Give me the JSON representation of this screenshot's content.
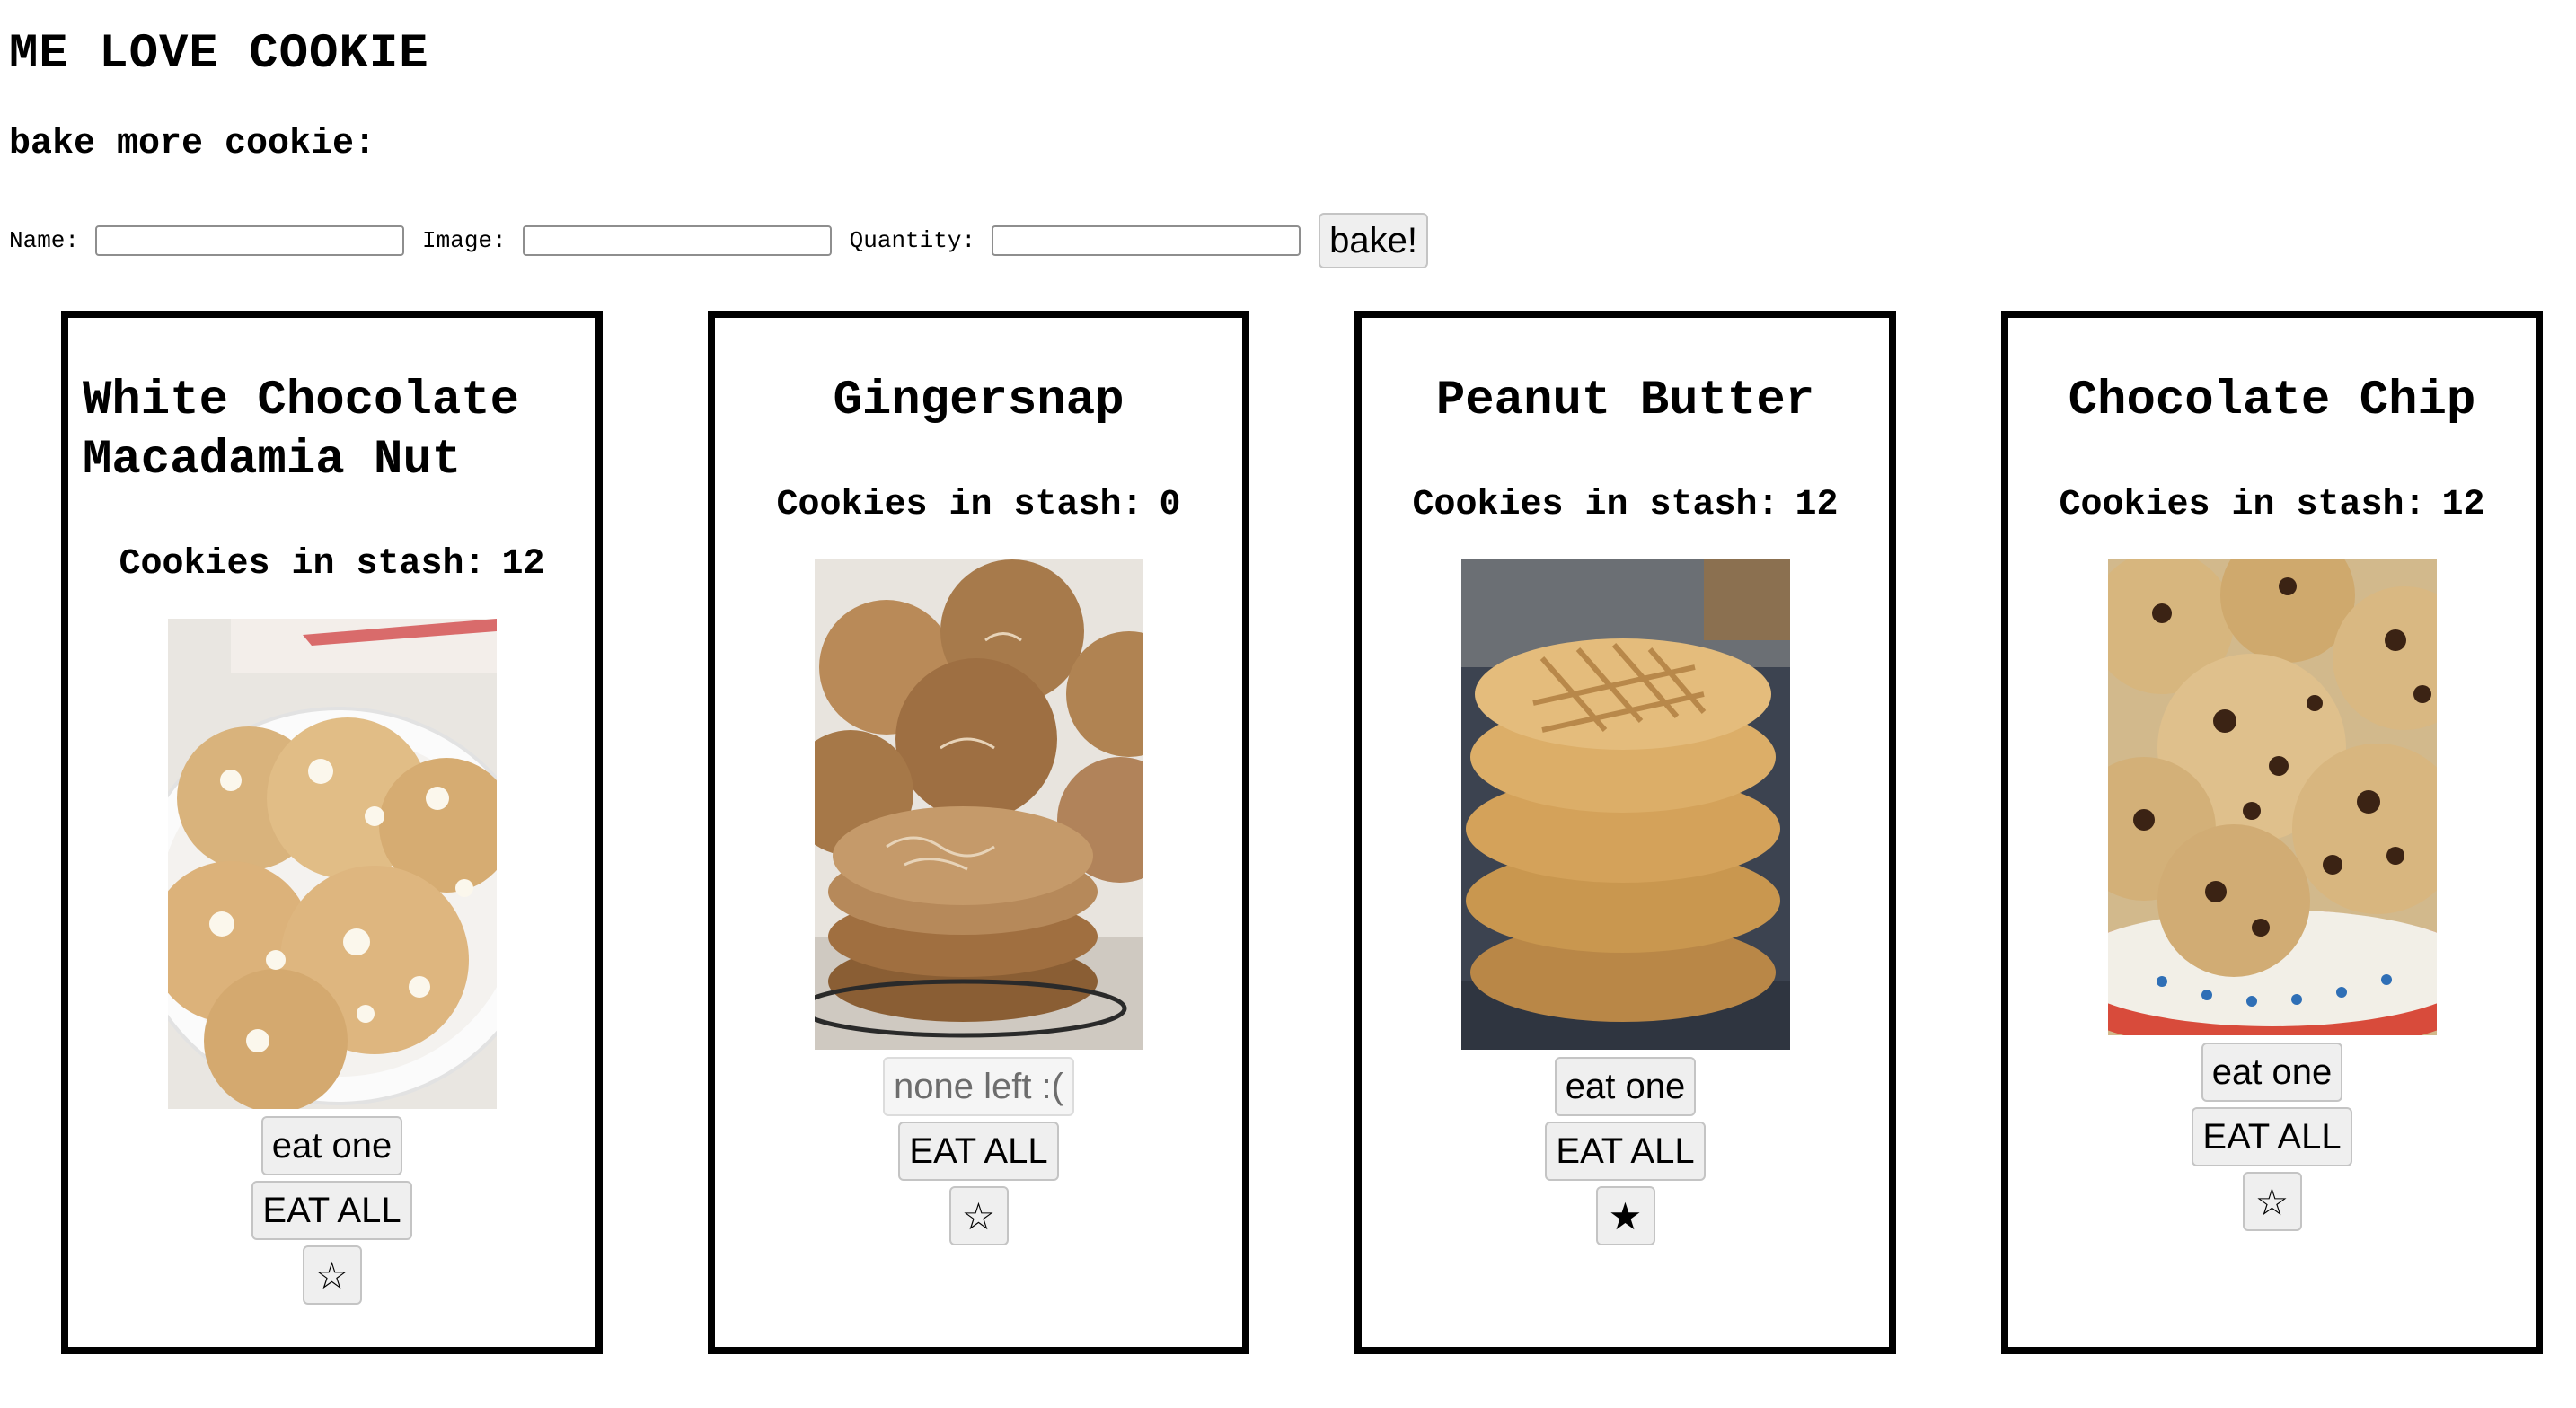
{
  "header": {
    "title": "ME LOVE COOKIE",
    "subtitle": "bake more cookie:"
  },
  "form": {
    "name_label": "Name:",
    "image_label": "Image:",
    "quantity_label": "Quantity:",
    "name_value": "",
    "image_value": "",
    "quantity_value": "",
    "bake_label": "bake!"
  },
  "cookies": [
    {
      "name": "White Chocolate Macadamia Nut",
      "stash_label": "Cookies in stash:",
      "count": "12",
      "eat_one_label": "eat one",
      "eat_all_label": "EAT ALL",
      "favorite": false,
      "star_icon": "☆"
    },
    {
      "name": "Gingersnap",
      "stash_label": "Cookies in stash:",
      "count": "0",
      "eat_one_label": "none left :(",
      "eat_all_label": "EAT ALL",
      "favorite": false,
      "star_icon": "☆"
    },
    {
      "name": "Peanut Butter",
      "stash_label": "Cookies in stash:",
      "count": "12",
      "eat_one_label": "eat one",
      "eat_all_label": "EAT ALL",
      "favorite": true,
      "star_icon": "★"
    },
    {
      "name": "Chocolate Chip",
      "stash_label": "Cookies in stash:",
      "count": "12",
      "eat_one_label": "eat one",
      "eat_all_label": "EAT ALL",
      "favorite": false,
      "star_icon": "☆"
    }
  ]
}
